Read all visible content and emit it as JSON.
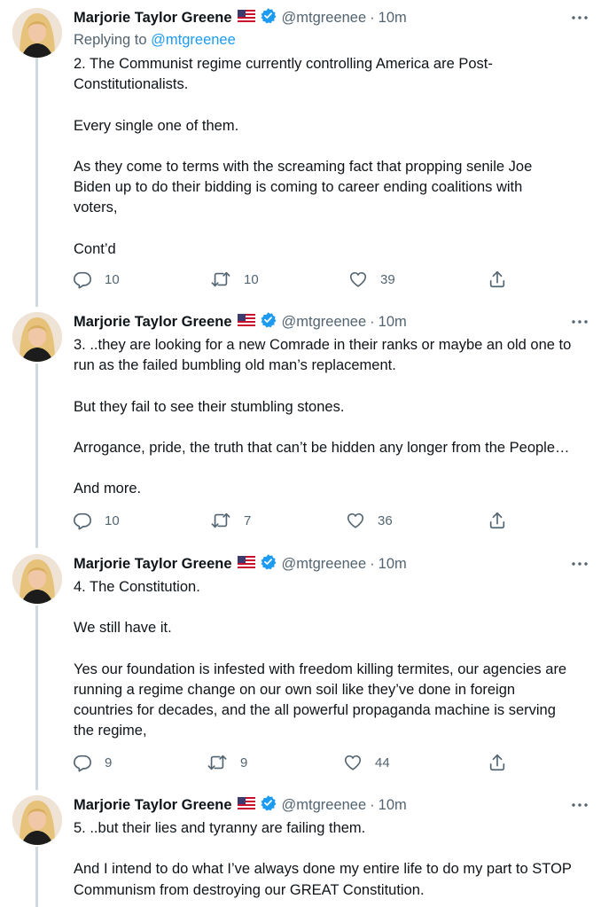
{
  "tweets": [
    {
      "author": {
        "name": "Marjorie Taylor Greene",
        "handle": "@mtgreenee",
        "time": "10m"
      },
      "replying_to": {
        "label": "Replying to",
        "mention": "@mtgreenee"
      },
      "text": "2. The Communist regime currently controlling America are Post-\nConstitutionalists.\n\nEvery single one of them.\n\nAs they come to terms with the screaming fact that propping senile Joe\nBiden up to do their bidding is coming to career ending coalitions with\nvoters,\n\nCont’d",
      "stats": {
        "replies": "10",
        "retweets": "10",
        "likes": "39"
      }
    },
    {
      "author": {
        "name": "Marjorie Taylor Greene",
        "handle": "@mtgreenee",
        "time": "10m"
      },
      "text": "3. ..they are looking for a new  Comrade in their ranks or maybe an old one to\nrun as the failed bumbling old man’s replacement.\n\nBut they fail to see their stumbling stones.\n\nArrogance, pride, the truth that can’t be hidden any longer from the People…\n\nAnd more.",
      "stats": {
        "replies": "10",
        "retweets": "7",
        "likes": "36"
      }
    },
    {
      "author": {
        "name": "Marjorie Taylor Greene",
        "handle": "@mtgreenee",
        "time": "10m"
      },
      "text": "4. The Constitution.\n\nWe still have it.\n\nYes our foundation is infested with freedom killing termites, our agencies are\nrunning a regime change on our own soil like they’ve done in foreign\ncountries for decades, and the all powerful propaganda machine is serving\nthe regime,",
      "stats": {
        "replies": "9",
        "retweets": "9",
        "likes": "44"
      }
    },
    {
      "author": {
        "name": "Marjorie Taylor Greene",
        "handle": "@mtgreenee",
        "time": "10m"
      },
      "text": "5. ..but their lies and tyranny are failing them.\n\nAnd I intend to do what I’ve always done my entire life to do my part to STOP\nCommunism from destroying our GREAT Constitution."
    }
  ],
  "icons": {
    "flag": "us-flag-icon",
    "verified": "verified-badge-icon",
    "more": "more-options-icon",
    "reply": "reply-icon",
    "retweet": "retweet-icon",
    "like": "like-icon",
    "share": "share-icon"
  },
  "colors": {
    "accent": "#1d9bf0",
    "secondary_text": "#536471",
    "thread_line": "#cfd9de"
  }
}
